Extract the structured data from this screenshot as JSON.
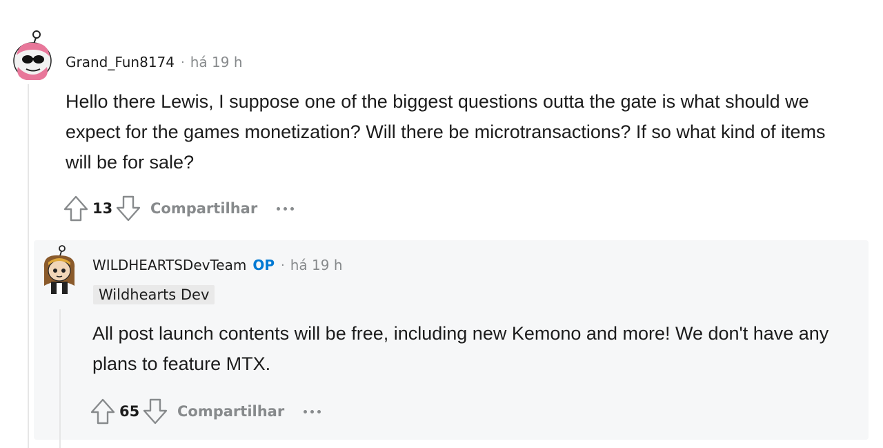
{
  "comment": {
    "username": "Grand_Fun8174",
    "separator": "·",
    "time": "há 19 h",
    "text": "Hello there Lewis, I suppose one of the biggest questions outta the gate is what should we expect for the games monetization? Will there be microtransactions? If so what kind of items will be for sale?",
    "score": "13",
    "share_label": "Compartilhar"
  },
  "reply": {
    "username": "WILDHEARTSDevTeam",
    "op_badge": "OP",
    "separator": "·",
    "time": "há 19 h",
    "flair": "Wildhearts Dev",
    "text": "All post launch contents will be free, including new Kemono and more! We don't have any plans to feature MTX.",
    "score": "65",
    "share_label": "Compartilhar"
  },
  "colors": {
    "op_blue": "#0079d3",
    "meta_gray": "#878a8c",
    "reply_bg": "#f6f7f8"
  }
}
